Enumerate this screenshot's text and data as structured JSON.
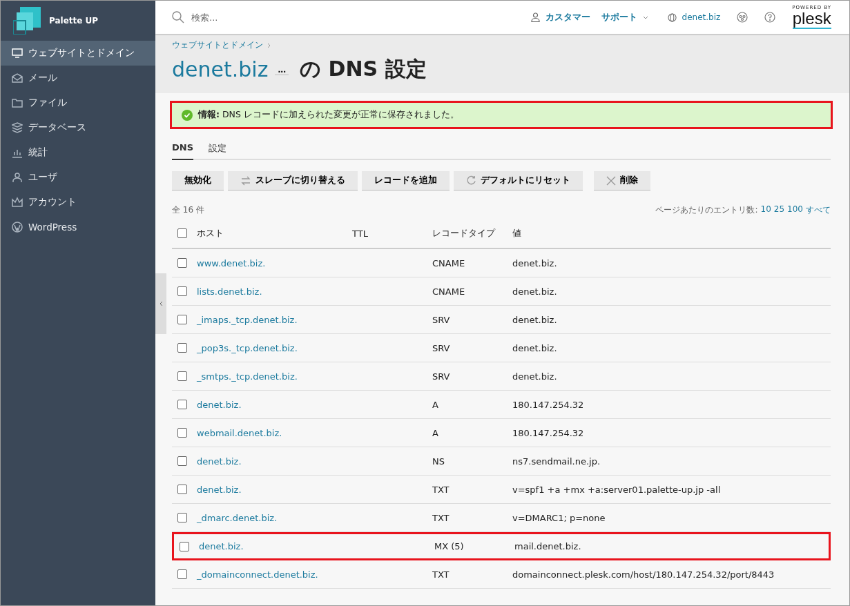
{
  "brand": {
    "name": "Palette UP"
  },
  "sidebar": {
    "items": [
      {
        "label": "ウェブサイトとドメイン",
        "selected": true
      },
      {
        "label": "メール",
        "selected": false
      },
      {
        "label": "ファイル",
        "selected": false
      },
      {
        "label": "データベース",
        "selected": false
      },
      {
        "label": "統計",
        "selected": false
      },
      {
        "label": "ユーザ",
        "selected": false
      },
      {
        "label": "アカウント",
        "selected": false
      },
      {
        "label": "WordPress",
        "selected": false
      }
    ]
  },
  "header": {
    "search_placeholder": "検索...",
    "user": "カスタマー",
    "support": "サポート",
    "domain": "denet.biz",
    "powered_by": "POWERED BY",
    "plesk": "plesk"
  },
  "breadcrumb": "ウェブサイトとドメイン",
  "page_title": {
    "domain": "denet.biz",
    "more": "...",
    "rest": "の DNS 設定"
  },
  "message": {
    "text": "**情報:** DNS レコードに加えられた変更が正常に保存されました。",
    "highlighted": true
  },
  "tabs": [
    {
      "label": "DNS",
      "selected": true
    },
    {
      "label": "設定",
      "selected": false
    }
  ],
  "toolbar": [
    "無効化",
    "スレーブに切り替える",
    "レコードを追加",
    "デフォルトにリセット",
    "削除"
  ],
  "total": "全 16 件",
  "pager": {
    "label": "ページあたりのエントリ数:",
    "options": [
      "10",
      "25",
      "100",
      "すべて"
    ]
  },
  "table": {
    "select_all_checked": false,
    "columns": [
      "ホスト",
      "TTL",
      "レコードタイプ",
      "値"
    ],
    "rows": [
      {
        "host": "www.denet.biz.",
        "type": "CNAME",
        "value": "denet.biz.",
        "checked": false,
        "highlighted": false
      },
      {
        "host": "lists.denet.biz.",
        "type": "CNAME",
        "value": "denet.biz.",
        "checked": false,
        "highlighted": false
      },
      {
        "host": "_imaps._tcp.denet.biz.",
        "type": "SRV",
        "value": "denet.biz.",
        "checked": false,
        "highlighted": false
      },
      {
        "host": "_pop3s._tcp.denet.biz.",
        "type": "SRV",
        "value": "denet.biz.",
        "checked": false,
        "highlighted": false
      },
      {
        "host": "_smtps._tcp.denet.biz.",
        "type": "SRV",
        "value": "denet.biz.",
        "checked": false,
        "highlighted": false
      },
      {
        "host": "denet.biz.",
        "type": "A",
        "value": "180.147.254.32",
        "checked": false,
        "highlighted": false
      },
      {
        "host": "webmail.denet.biz.",
        "type": "A",
        "value": "180.147.254.32",
        "checked": false,
        "highlighted": false
      },
      {
        "host": "denet.biz.",
        "type": "NS",
        "value": "ns7.sendmail.ne.jp.",
        "checked": false,
        "highlighted": false
      },
      {
        "host": "denet.biz.",
        "type": "TXT",
        "value": "v=spf1 +a +mx +a:server01.palette-up.jp -all",
        "checked": false,
        "highlighted": false
      },
      {
        "host": "_dmarc.denet.biz.",
        "type": "TXT",
        "value": "v=DMARC1; p=none",
        "checked": false,
        "highlighted": false
      },
      {
        "host": "denet.biz.",
        "type": "MX (5)",
        "value": "mail.denet.biz.",
        "checked": false,
        "highlighted": true
      },
      {
        "host": "_domainconnect.denet.biz.",
        "type": "TXT",
        "value": "domainconnect.plesk.com/host/180.147.254.32/port/8443",
        "checked": false,
        "highlighted": false
      }
    ]
  }
}
